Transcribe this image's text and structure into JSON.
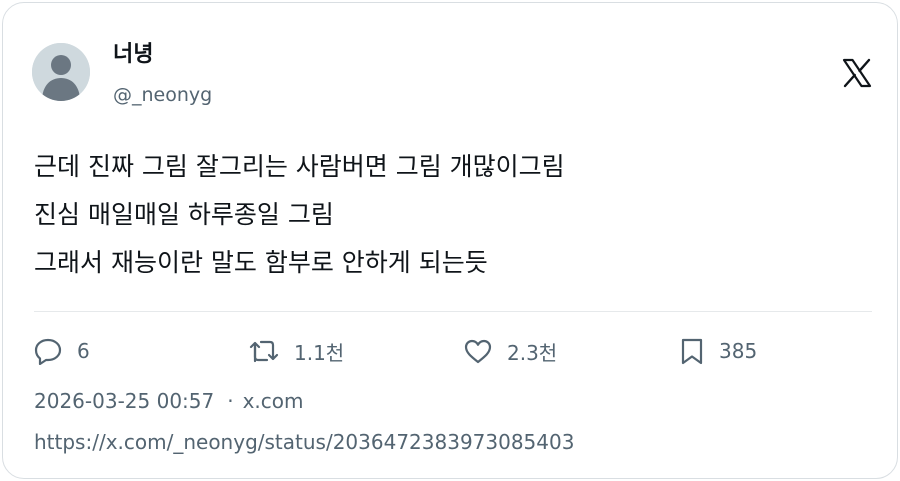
{
  "author": {
    "display_name": "너녕",
    "handle": "@_neonyg"
  },
  "tweet": {
    "lines": [
      "근데 진짜 그림 잘그리는 사람버면 그림 개많이그림",
      "진심 매일매일 하루종일 그림",
      "그래서 재능이란 말도 함부로 안하게 되는듯"
    ]
  },
  "actions": {
    "replies": "6",
    "retweets": "1.1천",
    "likes": "2.3천",
    "bookmarks": "385"
  },
  "meta": {
    "timestamp": "2026-03-25 00:57",
    "separator": "·",
    "source": "x.com"
  },
  "url": "https://x.com/_neonyg/status/2036472383973085403",
  "icons": {
    "brand": "x-logo-icon",
    "reply": "reply-icon",
    "retweet": "retweet-icon",
    "like": "heart-icon",
    "bookmark": "bookmark-icon"
  },
  "colors": {
    "text_primary": "#0f1419",
    "text_secondary": "#536471",
    "avatar_bg": "#cfd9de",
    "border": "#d9dee2"
  }
}
